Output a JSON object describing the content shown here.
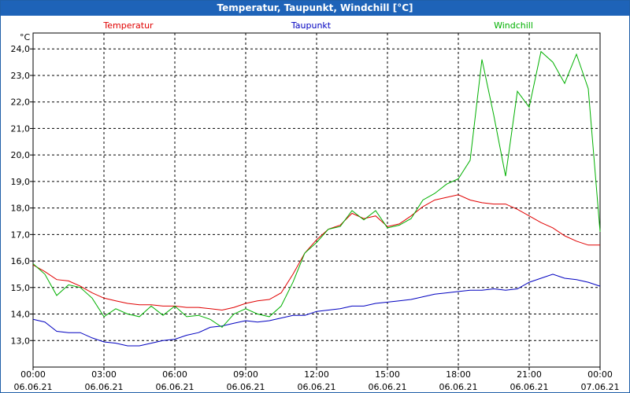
{
  "window": {
    "title": "Temperatur, Taupunkt, Windchill [°C]"
  },
  "chart_data": {
    "type": "line",
    "title": "Temperatur, Taupunkt, Windchill [°C]",
    "ylabel": "°C",
    "xlabel": "",
    "ylim": [
      12.0,
      24.6
    ],
    "xlim": [
      0,
      24
    ],
    "grid": true,
    "legend_position": "top",
    "y_ticks": [
      "13,0",
      "14,0",
      "15,0",
      "16,0",
      "17,0",
      "18,0",
      "19,0",
      "20,0",
      "21,0",
      "22,0",
      "23,0",
      "24,0"
    ],
    "y_tick_values": [
      13,
      14,
      15,
      16,
      17,
      18,
      19,
      20,
      21,
      22,
      23,
      24
    ],
    "x_tick_values": [
      0,
      3,
      6,
      9,
      12,
      15,
      18,
      21,
      24
    ],
    "x_ticks_time": [
      "00:00",
      "03:00",
      "06:00",
      "09:00",
      "12:00",
      "15:00",
      "18:00",
      "21:00",
      "00:00"
    ],
    "x_ticks_date": [
      "06.06.21",
      "06.06.21",
      "06.06.21",
      "06.06.21",
      "06.06.21",
      "06.06.21",
      "06.06.21",
      "06.06.21",
      "07.06.21"
    ],
    "series": [
      {
        "name": "Temperatur",
        "color": "#e00000",
        "x": [
          0,
          0.5,
          1,
          1.5,
          2,
          2.5,
          3,
          3.5,
          4,
          4.5,
          5,
          5.5,
          6,
          6.5,
          7,
          7.5,
          8,
          8.5,
          9,
          9.5,
          10,
          10.5,
          11,
          11.5,
          12,
          12.5,
          13,
          13.5,
          14,
          14.5,
          15,
          15.5,
          16,
          16.5,
          17,
          17.5,
          18,
          18.5,
          19,
          19.5,
          20,
          20.5,
          21,
          21.5,
          22,
          22.5,
          23,
          23.5,
          24
        ],
        "values": [
          15.85,
          15.6,
          15.3,
          15.25,
          15.05,
          14.8,
          14.6,
          14.5,
          14.4,
          14.35,
          14.35,
          14.3,
          14.3,
          14.25,
          14.25,
          14.2,
          14.15,
          14.25,
          14.4,
          14.5,
          14.55,
          14.8,
          15.5,
          16.3,
          16.8,
          17.2,
          17.35,
          17.8,
          17.6,
          17.7,
          17.3,
          17.4,
          17.7,
          18.05,
          18.3,
          18.4,
          18.5,
          18.3,
          18.2,
          18.15,
          18.15,
          17.95,
          17.7,
          17.45,
          17.25,
          16.95,
          16.75,
          16.6,
          16.6
        ]
      },
      {
        "name": "Taupunkt",
        "color": "#0000c0",
        "x": [
          0,
          0.5,
          1,
          1.5,
          2,
          2.5,
          3,
          3.5,
          4,
          4.5,
          5,
          5.5,
          6,
          6.5,
          7,
          7.5,
          8,
          8.5,
          9,
          9.5,
          10,
          10.5,
          11,
          11.5,
          12,
          12.5,
          13,
          13.5,
          14,
          14.5,
          15,
          15.5,
          16,
          16.5,
          17,
          17.5,
          18,
          18.5,
          19,
          19.5,
          20,
          20.5,
          21,
          21.5,
          22,
          22.5,
          23,
          23.5,
          24
        ],
        "values": [
          13.8,
          13.7,
          13.35,
          13.3,
          13.3,
          13.1,
          12.95,
          12.9,
          12.8,
          12.8,
          12.9,
          13.0,
          13.05,
          13.2,
          13.3,
          13.5,
          13.55,
          13.65,
          13.75,
          13.7,
          13.75,
          13.85,
          13.95,
          13.95,
          14.1,
          14.15,
          14.2,
          14.3,
          14.3,
          14.4,
          14.45,
          14.5,
          14.55,
          14.65,
          14.75,
          14.8,
          14.85,
          14.9,
          14.9,
          14.95,
          14.9,
          14.95,
          15.2,
          15.35,
          15.5,
          15.35,
          15.3,
          15.2,
          15.05
        ]
      },
      {
        "name": "Windchill",
        "color": "#00b000",
        "x": [
          0,
          0.5,
          1,
          1.5,
          2,
          2.5,
          3,
          3.5,
          4,
          4.5,
          5,
          5.5,
          6,
          6.5,
          7,
          7.5,
          8,
          8.5,
          9,
          9.5,
          10,
          10.5,
          11,
          11.5,
          12,
          12.5,
          13,
          13.5,
          14,
          14.5,
          15,
          15.5,
          16,
          16.5,
          17,
          17.5,
          18,
          18.5,
          19,
          19.5,
          20,
          20.5,
          21,
          21.5,
          22,
          22.5,
          23,
          23.5,
          24
        ],
        "values": [
          15.9,
          15.5,
          14.7,
          15.1,
          15.0,
          14.6,
          13.9,
          14.2,
          14.0,
          13.9,
          14.3,
          13.95,
          14.3,
          13.9,
          13.95,
          13.8,
          13.5,
          14.0,
          14.2,
          14.0,
          13.9,
          14.3,
          15.2,
          16.3,
          16.7,
          17.2,
          17.3,
          17.9,
          17.55,
          17.9,
          17.25,
          17.35,
          17.6,
          18.3,
          18.55,
          18.9,
          19.1,
          19.8,
          23.6,
          21.5,
          19.2,
          22.4,
          21.8,
          23.9,
          23.5,
          22.7,
          23.8,
          22.5,
          17.1
        ]
      }
    ]
  }
}
